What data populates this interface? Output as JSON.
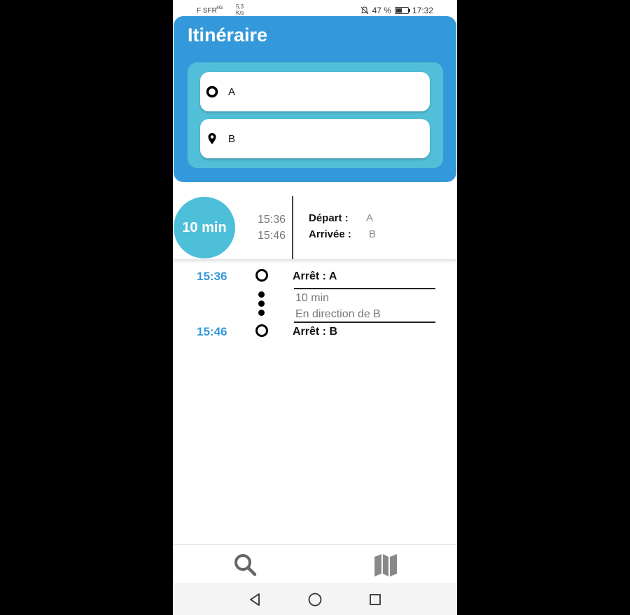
{
  "status": {
    "carrier": "F SFR",
    "net": "4G",
    "speed": "5,3 K/s",
    "battery": "47 %",
    "time": "17:32"
  },
  "header": {
    "title": "Itinéraire"
  },
  "inputs": {
    "from": "A",
    "to": "B"
  },
  "summary": {
    "duration": "10 min",
    "depart_time": "15:36",
    "arrive_time": "15:46",
    "depart_label": "Départ :",
    "arrive_label": "Arrivée :",
    "depart_value": "A",
    "arrive_value": "B"
  },
  "timeline": {
    "start_time": "15:36",
    "start_stop": "Arrêt : A",
    "duration": "10 min",
    "direction": "En direction de B",
    "end_time": "15:46",
    "end_stop": "Arrêt : B"
  },
  "nav": {
    "icons": [
      "search-icon",
      "map-icon"
    ]
  },
  "colors": {
    "primary": "#3499da",
    "accent": "#52bfd9"
  }
}
